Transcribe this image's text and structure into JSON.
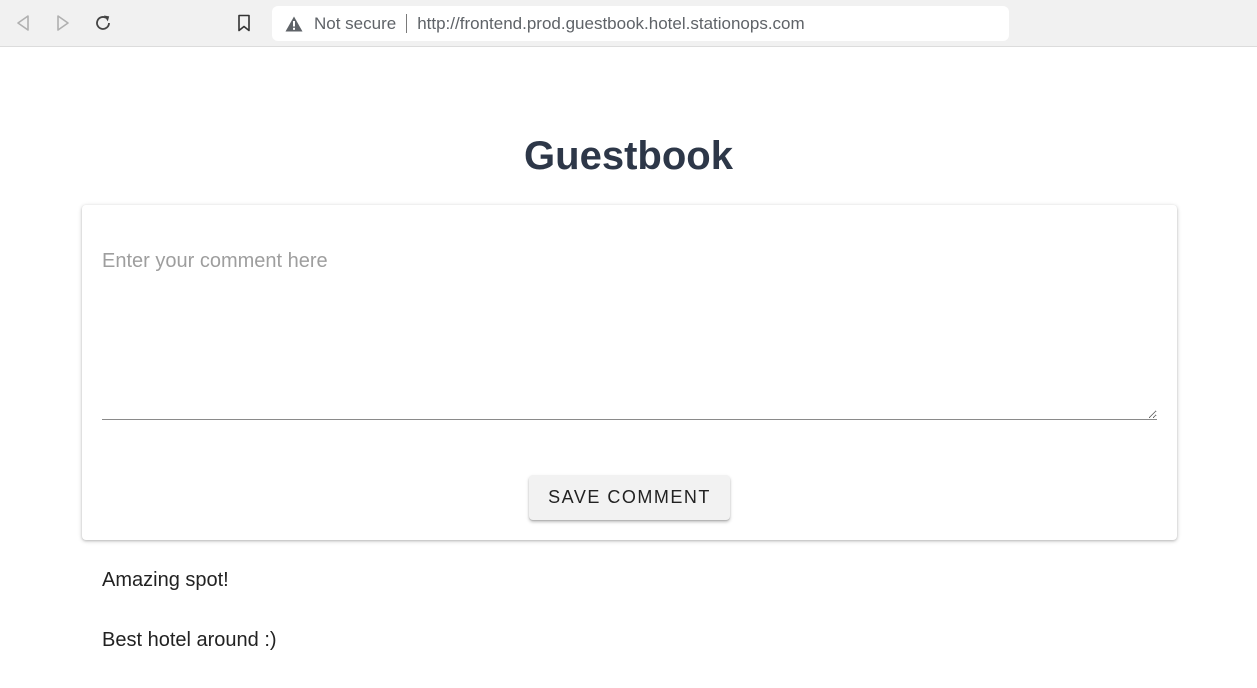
{
  "browser": {
    "security_label": "Not secure",
    "url": "http://frontend.prod.guestbook.hotel.stationops.com",
    "icons": {
      "back": "arrow-left-icon",
      "forward": "arrow-right-icon",
      "reload": "reload-icon",
      "bookmark": "bookmark-icon",
      "security": "warning-triangle-icon"
    }
  },
  "page": {
    "title": "Guestbook"
  },
  "form": {
    "comment_placeholder": "Enter your comment here",
    "comment_value": "",
    "save_label": "SAVE COMMENT"
  },
  "comments": [
    {
      "text": "Amazing spot!"
    },
    {
      "text": "Best hotel around :)"
    }
  ],
  "colors": {
    "title": "#2d3748",
    "toolbar_bg": "#f1f1f1",
    "button_bg": "#f2f2f2"
  }
}
